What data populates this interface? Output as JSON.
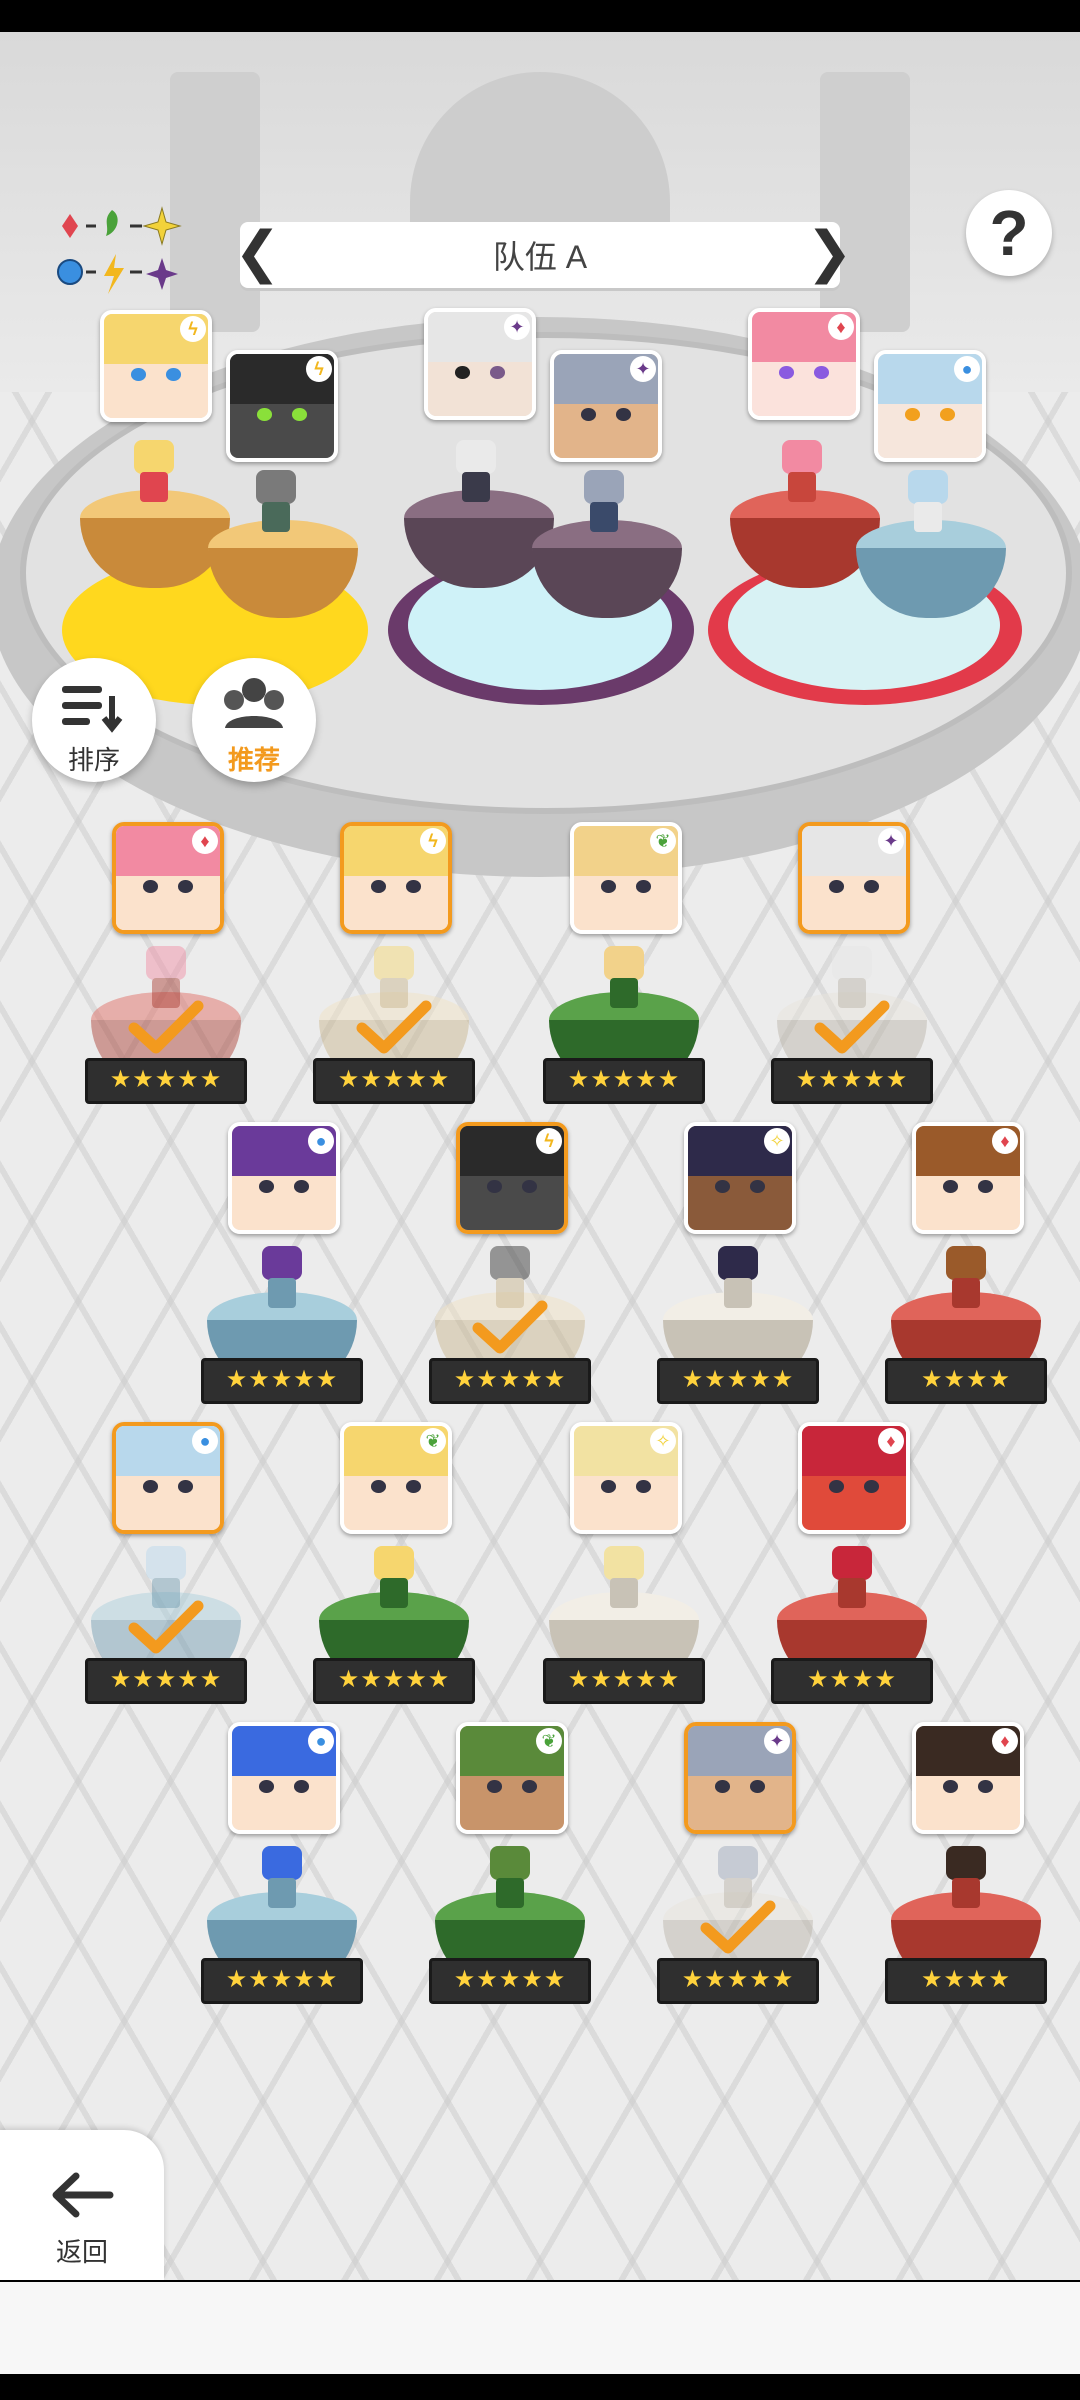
{
  "team": {
    "name": "队伍 A"
  },
  "help": {
    "label": "?"
  },
  "buttons": {
    "sort": "排序",
    "recommend": "推荐",
    "back": "返回"
  },
  "element_chart": {
    "icons": [
      "red-diamond-icon",
      "green-leaf-icon",
      "yellow-sparkle-icon",
      "blue-orb-icon",
      "yellow-lightning-icon",
      "purple-star-icon"
    ]
  },
  "colors": {
    "selected_border": "#f39a1e",
    "fire": "#e0454f",
    "nature": "#4aa23a",
    "light": "#f2d23a",
    "water": "#3a8fe0",
    "thunder": "#f2b71e",
    "dark": "#6a3a8a",
    "pedestal_gold": "#e6b25a",
    "pedestal_purple": "#6e5a6e",
    "pedestal_red": "#c8463c",
    "pedestal_blue": "#8cb4c8",
    "pedestal_green": "#3f8a3a",
    "pedestal_white": "#e8e4dc"
  },
  "team_slots": [
    {
      "ring": "yellow",
      "heroes": [
        "blonde-bunny-girl",
        "dark-knight"
      ]
    },
    {
      "ring": "cyan",
      "heroes": [
        "white-hair-eyepatch",
        "grey-beard-man"
      ]
    },
    {
      "ring": "red",
      "heroes": [
        "pink-hair-girl",
        "silver-hair-girl"
      ]
    }
  ],
  "roster_rows": [
    [
      {
        "name": "pink-hair-girl",
        "element": "fire",
        "stars": "★★★★★",
        "selected": true
      },
      {
        "name": "blonde-bunny-girl",
        "element": "thunder",
        "stars": "★★★★★",
        "selected": true
      },
      {
        "name": "hat-blonde-girl",
        "element": "nature",
        "stars": "★★★★★",
        "selected": false
      },
      {
        "name": "white-hair-eyepatch",
        "element": "dark",
        "stars": "★★★★★",
        "selected": true
      }
    ],
    [
      {
        "name": "purple-hair-girl",
        "element": "water",
        "stars": "★★★★★",
        "selected": false
      },
      {
        "name": "dark-knight",
        "element": "thunder",
        "stars": "★★★★★",
        "selected": true
      },
      {
        "name": "dark-skin-girl",
        "element": "light",
        "stars": "★★★★★",
        "selected": false
      },
      {
        "name": "brown-hair-boy",
        "element": "fire",
        "stars": "★★★★",
        "selected": false
      }
    ],
    [
      {
        "name": "silver-hair-girl",
        "element": "water",
        "stars": "★★★★★",
        "selected": true
      },
      {
        "name": "blonde-twin-girl",
        "element": "nature",
        "stars": "★★★★★",
        "selected": false
      },
      {
        "name": "blonde-bow-girl",
        "element": "light",
        "stars": "★★★★★",
        "selected": false
      },
      {
        "name": "red-dragon",
        "element": "fire",
        "stars": "★★★★",
        "selected": false
      }
    ],
    [
      {
        "name": "blue-hair-girl",
        "element": "water",
        "stars": "★★★★★",
        "selected": false
      },
      {
        "name": "green-hair-man",
        "element": "nature",
        "stars": "★★★★★",
        "selected": false
      },
      {
        "name": "grey-beard-man",
        "element": "dark",
        "stars": "★★★★★",
        "selected": true
      },
      {
        "name": "dark-hair-girl",
        "element": "fire",
        "stars": "★★★★",
        "selected": false
      }
    ]
  ]
}
